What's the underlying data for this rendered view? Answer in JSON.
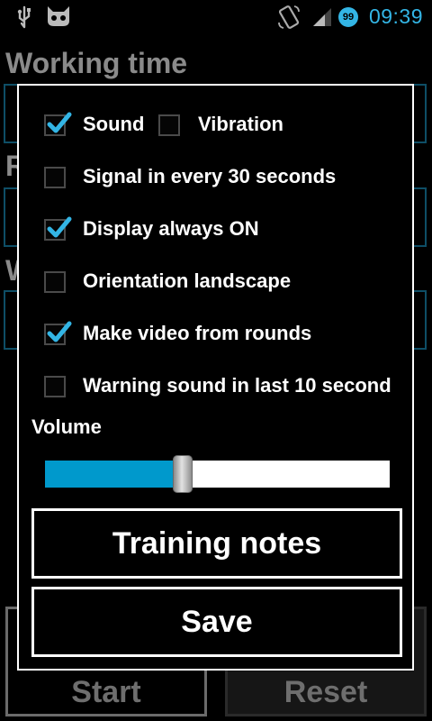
{
  "status_bar": {
    "time": "09:39",
    "notification_badge": "99",
    "icons": [
      "usb-icon",
      "cyanogen-mascot-icon",
      "screen-rotate-icon",
      "signal-strength-icon",
      "notification-badge-icon"
    ],
    "accent_color": "#33b5e5"
  },
  "background_app": {
    "title": "Working time",
    "row2_letter": "R",
    "row3_letter": "W",
    "start_label": "Start",
    "reset_label": "Reset"
  },
  "dialog": {
    "options": [
      {
        "label": "Sound",
        "checked": true
      },
      {
        "label": "Vibration",
        "checked": false
      },
      {
        "label": "Signal in every 30 seconds",
        "checked": false
      },
      {
        "label": "Display always ON",
        "checked": true
      },
      {
        "label": "Orientation landscape",
        "checked": false
      },
      {
        "label": "Make video from rounds",
        "checked": true
      },
      {
        "label": "Warning sound in last 10 second",
        "checked": false
      }
    ],
    "volume_label": "Volume",
    "volume_fraction": 0.4,
    "slider_fill_color": "#0099cc",
    "training_notes_label": "Training notes",
    "save_label": "Save"
  }
}
